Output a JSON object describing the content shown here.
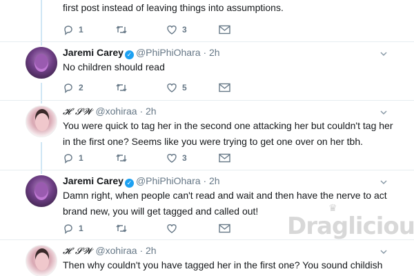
{
  "tweets": [
    {
      "author": "",
      "handle": "",
      "time": "",
      "text": "first post instead of leaving things into assumptions.",
      "replies": "1",
      "retweets": "",
      "likes": "3"
    },
    {
      "author": "Jaremi Carey",
      "handle": "@PhiPhiOhara",
      "time": "· 2h",
      "verified": true,
      "text": "No children should read",
      "replies": "2",
      "retweets": "",
      "likes": "5"
    },
    {
      "author": "𝓗 𝓢𝓦",
      "handle": "@xohiraa",
      "time": "· 2h",
      "text": "You were quick to tag her in the second one attacking her but couldn't tag her in the first one? Seems like you were trying to get one over on her tbh.",
      "replies": "1",
      "retweets": "",
      "likes": "3"
    },
    {
      "author": "Jaremi Carey",
      "handle": "@PhiPhiOhara",
      "time": "· 2h",
      "verified": true,
      "text": "Damn right, when people can't read and wait and then have the nerve to act brand new, you will get tagged and called out!",
      "replies": "1",
      "retweets": "",
      "likes": ""
    },
    {
      "author": "𝓗 𝓢𝓦",
      "handle": "@xohiraa",
      "time": "· 2h",
      "text": "Then why couldn't you have tagged her in the first one? You sound childish after",
      "replies": "",
      "retweets": "",
      "likes": ""
    }
  ],
  "watermark": {
    "text": "Draglicious",
    "crown": "♛"
  },
  "icons": {
    "reply": "reply-icon",
    "retweet": "retweet-icon",
    "like": "heart-icon",
    "dm": "envelope-icon",
    "caret": "chevron-down-icon",
    "verified": "verified-badge-icon"
  },
  "colors": {
    "thread_line": "#cfe6f4",
    "verified": "#1da1f2",
    "icon_gray": "#657786"
  }
}
